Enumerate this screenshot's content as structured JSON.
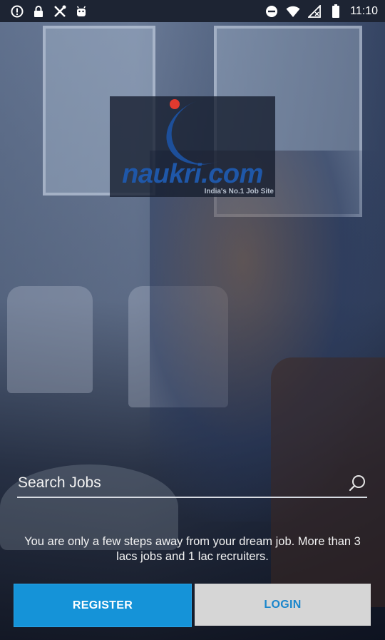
{
  "status_bar": {
    "time": "11:10",
    "left_icons": [
      "info-circle-icon",
      "lock-icon",
      "crossed-tools-icon",
      "android-icon"
    ],
    "right_icons": [
      "do-not-disturb-icon",
      "wifi-icon",
      "signal-off-icon",
      "battery-icon"
    ]
  },
  "logo": {
    "brand": "naukri.com",
    "tagline": "India's No.1 Job Site",
    "colors": {
      "blue": "#1f57a8",
      "red": "#e03a2f"
    }
  },
  "search": {
    "placeholder": "Search Jobs",
    "value": ""
  },
  "intro": {
    "text": "You are only a few steps away from your dream job. More than 3 lacs jobs and 1 lac recruiters."
  },
  "actions": {
    "register_label": "REGISTER",
    "login_label": "LOGIN",
    "register_color": "#1593d8",
    "login_color": "#d6d6d6"
  }
}
